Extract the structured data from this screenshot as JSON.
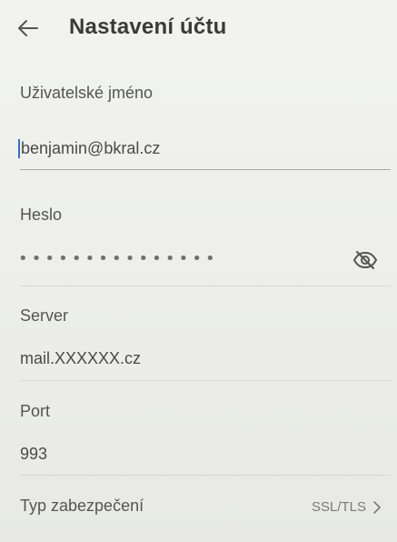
{
  "header": {
    "title": "Nastavení účtu",
    "back_icon": "arrow-left-icon"
  },
  "username": {
    "label": "Uživatelské jméno",
    "value": "benjamin@bkral.cz"
  },
  "password": {
    "label": "Heslo",
    "masked_value": "•••••••••••••••",
    "toggle_icon": "eye-slash-icon"
  },
  "server": {
    "label": "Server",
    "value": "mail.XXXXXX.cz"
  },
  "port": {
    "label": "Port",
    "value": "993"
  },
  "security": {
    "label": "Typ zabezpečení",
    "value": "SSL/TLS",
    "chevron_icon": "chevron-right-icon"
  },
  "colors": {
    "background": "#eef0ea",
    "text": "#3d3d3d",
    "cursor": "#2f6fd6"
  }
}
